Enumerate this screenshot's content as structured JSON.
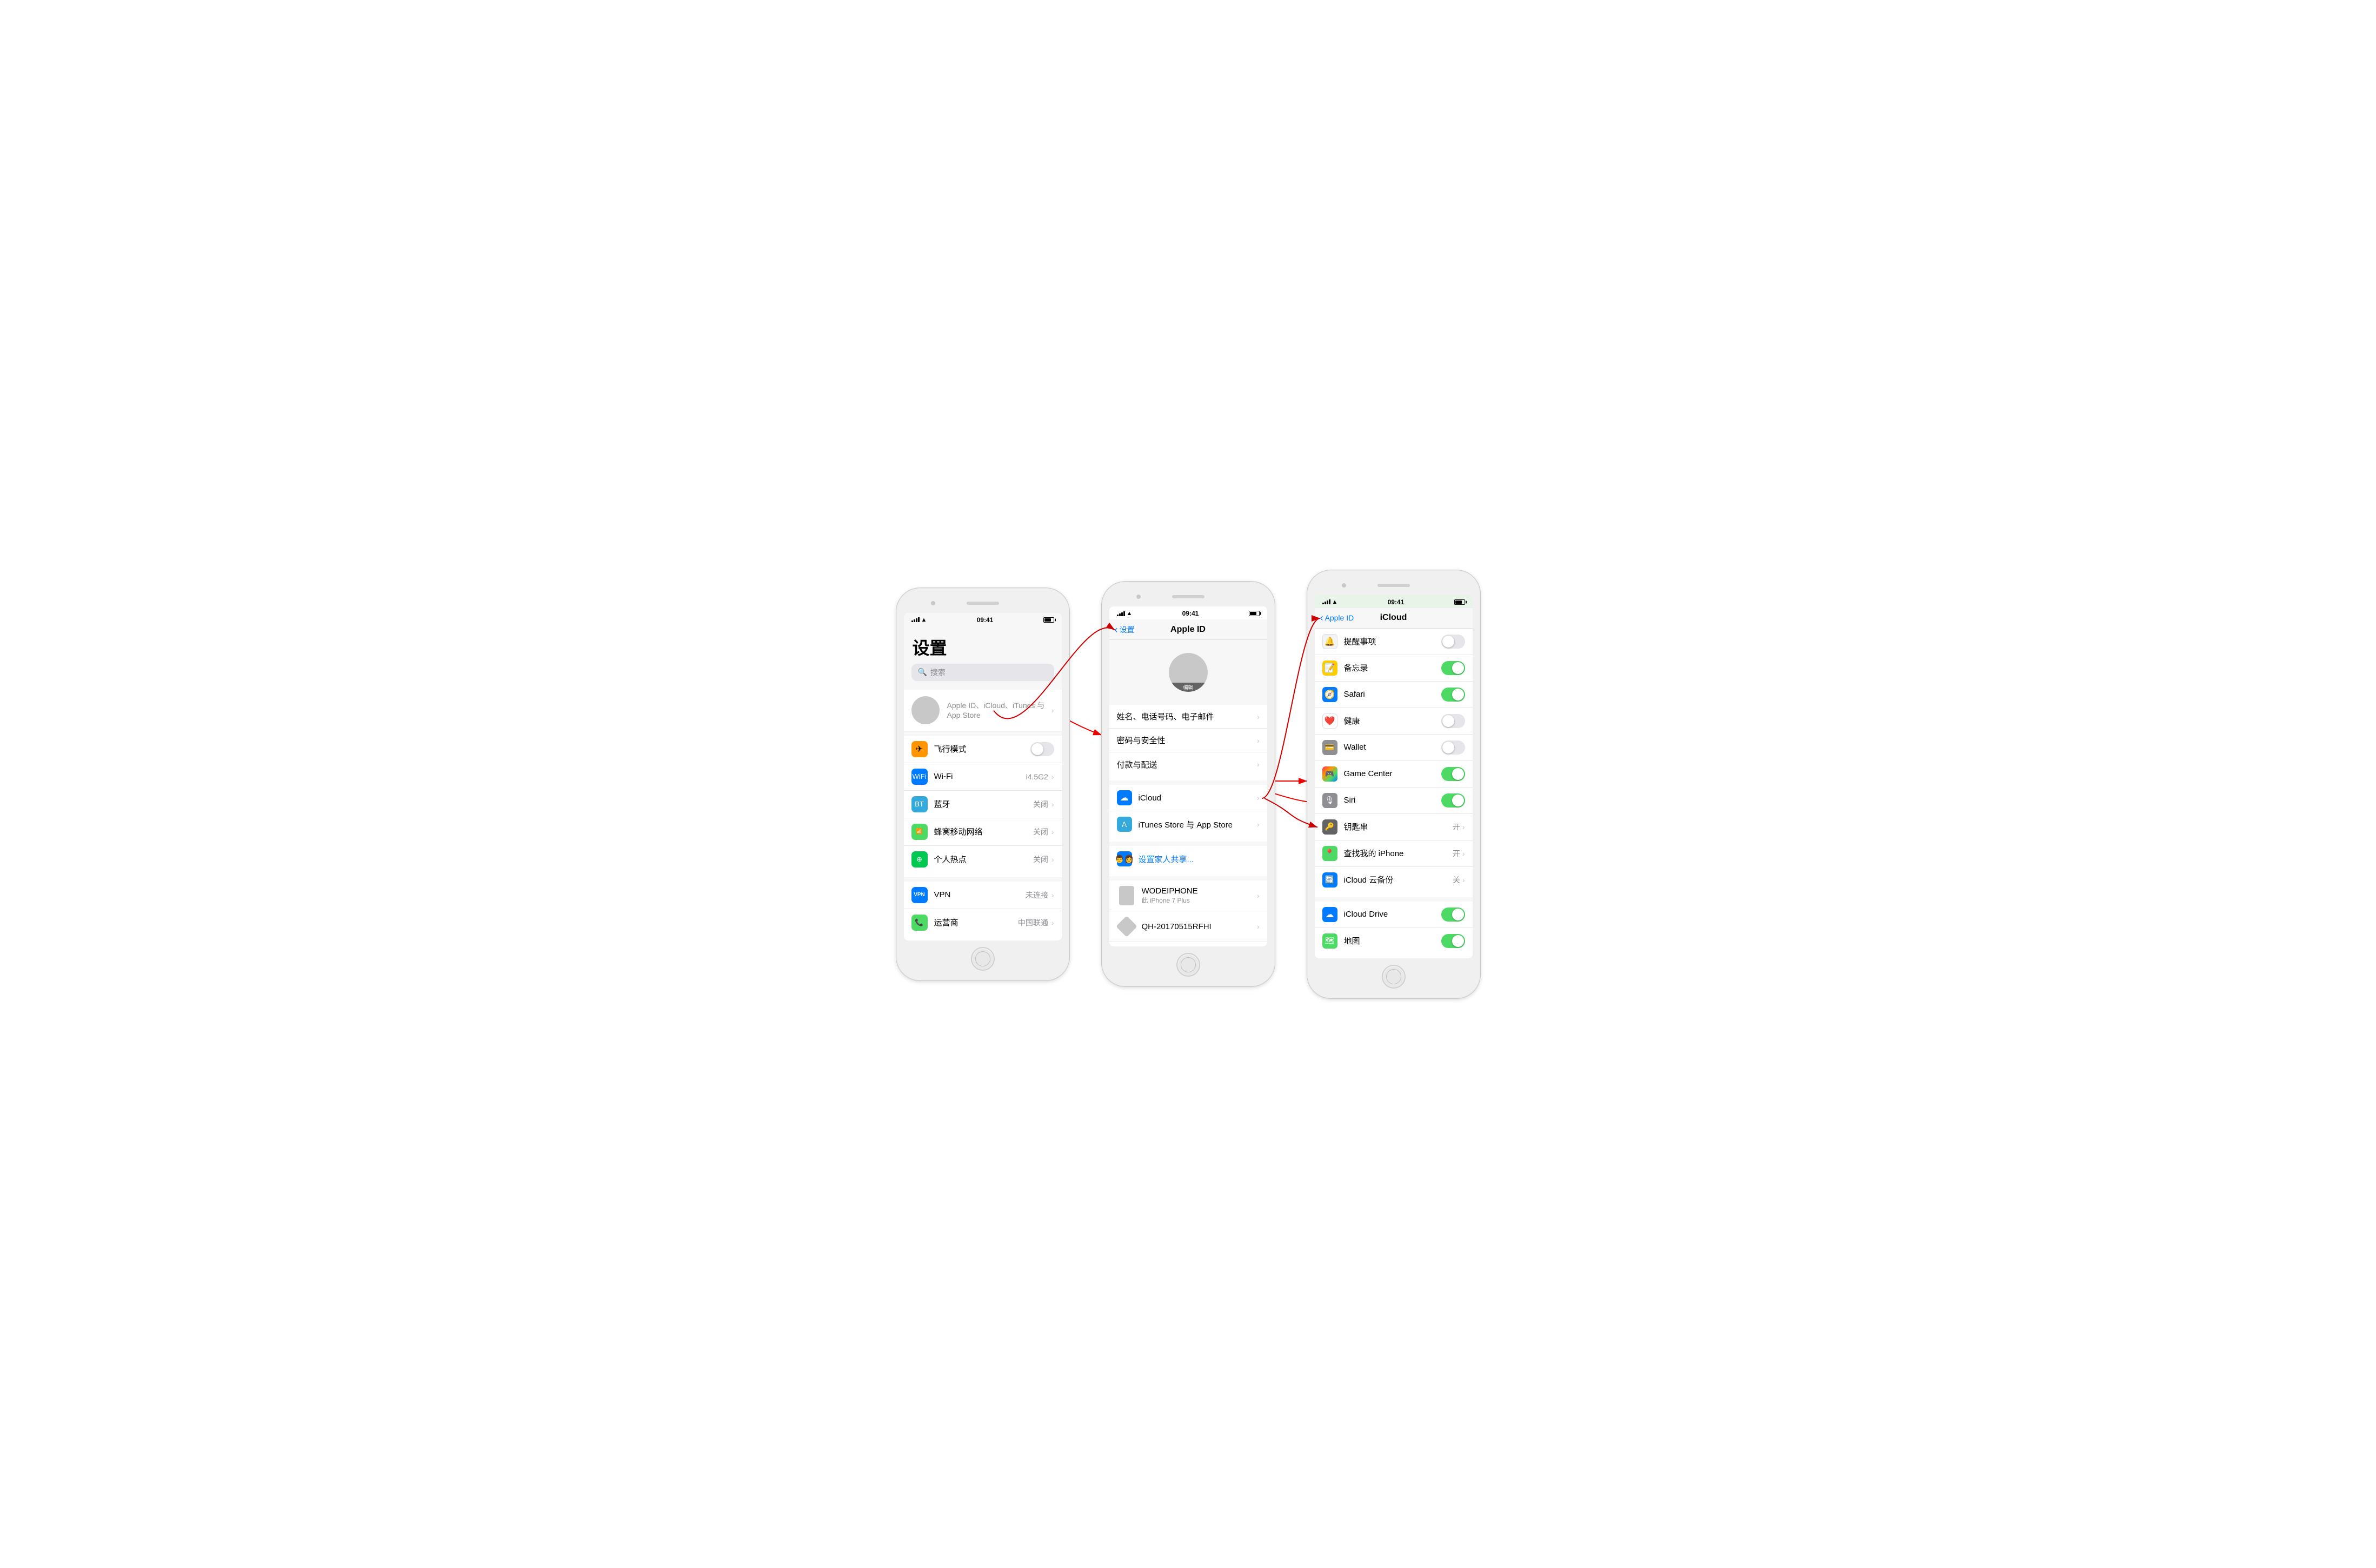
{
  "phone1": {
    "status": {
      "time": "09:41",
      "signal": [
        2,
        4,
        6,
        8,
        10
      ],
      "wifi": "wifi",
      "battery": "battery"
    },
    "title": "设置",
    "search_placeholder": "搜索",
    "account": {
      "label": "Apple ID、iCloud、iTunes 与 App Store"
    },
    "items": [
      {
        "icon_char": "✈",
        "icon_class": "icon-orange",
        "label": "飞行模式",
        "value": "",
        "toggle": "off"
      },
      {
        "icon_char": "wifi",
        "icon_class": "icon-blue",
        "label": "Wi-Fi",
        "value": "i4.5G2",
        "toggle": null
      },
      {
        "icon_char": "bluetooth",
        "icon_class": "icon-blue2",
        "label": "蓝牙",
        "value": "关闭",
        "toggle": null
      },
      {
        "icon_char": "signal",
        "icon_class": "icon-green",
        "label": "蜂窝移动网络",
        "value": "关闭",
        "toggle": null
      },
      {
        "icon_char": "hotspot",
        "icon_class": "icon-green2",
        "label": "个人热点",
        "value": "关闭",
        "toggle": null
      },
      {
        "icon_char": "VPN",
        "icon_class": "icon-blue",
        "label": "VPN",
        "value": "未连接",
        "toggle": null
      },
      {
        "icon_char": "phone",
        "icon_class": "icon-green",
        "label": "运营商",
        "value": "中国联通",
        "toggle": null
      }
    ]
  },
  "phone2": {
    "status": {
      "time": "09:41"
    },
    "nav": {
      "back": "设置",
      "title": "Apple ID"
    },
    "avatar_edit": "编辑",
    "menu_items": [
      {
        "label": "姓名、电话号码、电子邮件"
      },
      {
        "label": "密码与安全性"
      },
      {
        "label": "付款与配送"
      }
    ],
    "icloud_label": "iCloud",
    "itunes_label": "iTunes Store 与 App Store",
    "family_label": "设置家人共享...",
    "devices": [
      {
        "label": "WODEIPHONE",
        "sublabel": "此 iPhone 7 Plus"
      },
      {
        "label": "QH-20170515RFHI",
        "sublabel": ""
      }
    ]
  },
  "phone3": {
    "status": {
      "time": "09:41"
    },
    "nav": {
      "back": "Apple ID",
      "title": "iCloud"
    },
    "items": [
      {
        "icon_char": "🔔",
        "icon_class": "",
        "label": "提醒事项",
        "toggle": "off",
        "value": ""
      },
      {
        "icon_char": "📝",
        "icon_class": "icon-yellow",
        "label": "备忘录",
        "toggle": "on",
        "value": ""
      },
      {
        "icon_char": "🧭",
        "icon_class": "icon-red",
        "label": "Safari",
        "toggle": "on",
        "value": ""
      },
      {
        "icon_char": "❤",
        "icon_class": "",
        "label": "健康",
        "toggle": "off",
        "value": ""
      },
      {
        "icon_char": "💳",
        "icon_class": "icon-gray",
        "label": "Wallet",
        "toggle": "off",
        "value": ""
      },
      {
        "icon_char": "🎮",
        "icon_class": "icon-indigo",
        "label": "Game Center",
        "toggle": "on",
        "value": ""
      },
      {
        "icon_char": "🎙",
        "icon_class": "icon-gray",
        "label": "Siri",
        "toggle": "on",
        "value": ""
      },
      {
        "icon_char": "🔑",
        "icon_class": "key-icon",
        "label": "钥匙串",
        "toggle": null,
        "value": "开"
      },
      {
        "icon_char": "📍",
        "icon_class": "icon-green2",
        "label": "查找我的 iPhone",
        "toggle": null,
        "value": "开"
      },
      {
        "icon_char": "🔄",
        "icon_class": "icon-blue",
        "label": "iCloud 云备份",
        "toggle": null,
        "value": "关"
      },
      {
        "icon_char": "☁",
        "icon_class": "icon-blue",
        "label": "iCloud Drive",
        "toggle": "on",
        "value": ""
      },
      {
        "icon_char": "🗺",
        "icon_class": "icon-green",
        "label": "地图",
        "toggle": "on",
        "value": ""
      }
    ]
  },
  "arrows": {
    "arrow1": {
      "desc": "account-to-appleid"
    },
    "arrow2": {
      "desc": "icloud-to-icloud-screen"
    },
    "arrow3": {
      "desc": "icloud-to-keychain"
    }
  }
}
